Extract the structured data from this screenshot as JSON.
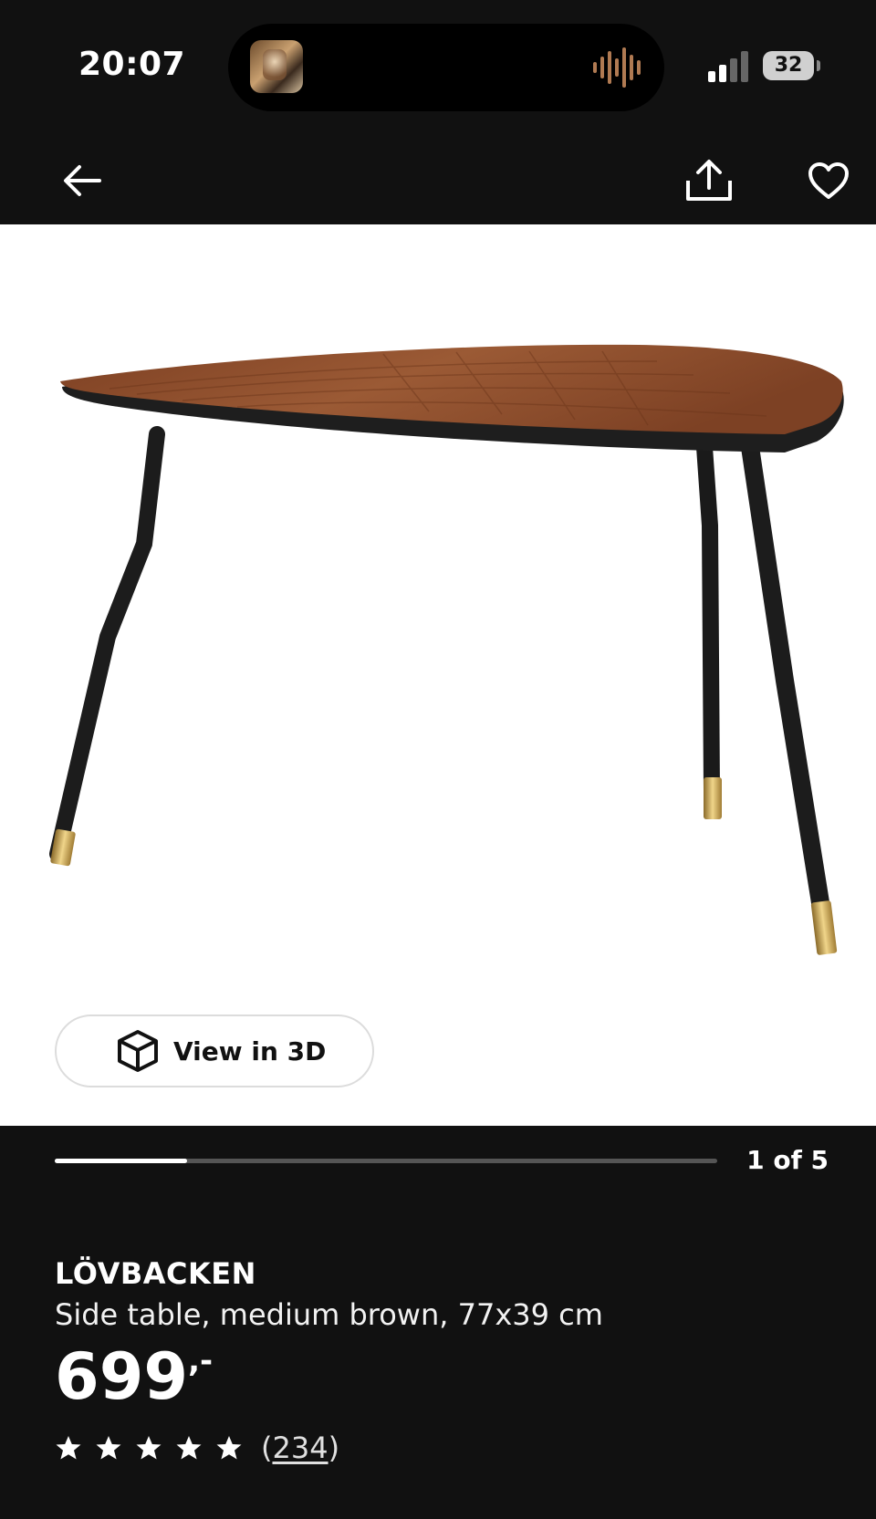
{
  "status_bar": {
    "time": "20:07",
    "battery": "32"
  },
  "product": {
    "name": "LÖVBACKEN",
    "description": "Side table, medium brown, 77x39 cm",
    "price": "699",
    "price_suffix": ",-",
    "rating_stars": 5,
    "review_count": "234"
  },
  "gallery": {
    "counter": "1 of 5",
    "progress_fraction": 0.2,
    "view_3d_label": "View in 3D"
  },
  "icons": {
    "back": "arrow-left-icon",
    "share": "share-icon",
    "favorite": "heart-icon",
    "cube": "cube-3d-icon",
    "star": "star-icon"
  },
  "colors": {
    "background": "#111111",
    "wood": "#8e4f2d",
    "legs": "#1c1c1c",
    "brass": "#c9a24a"
  }
}
